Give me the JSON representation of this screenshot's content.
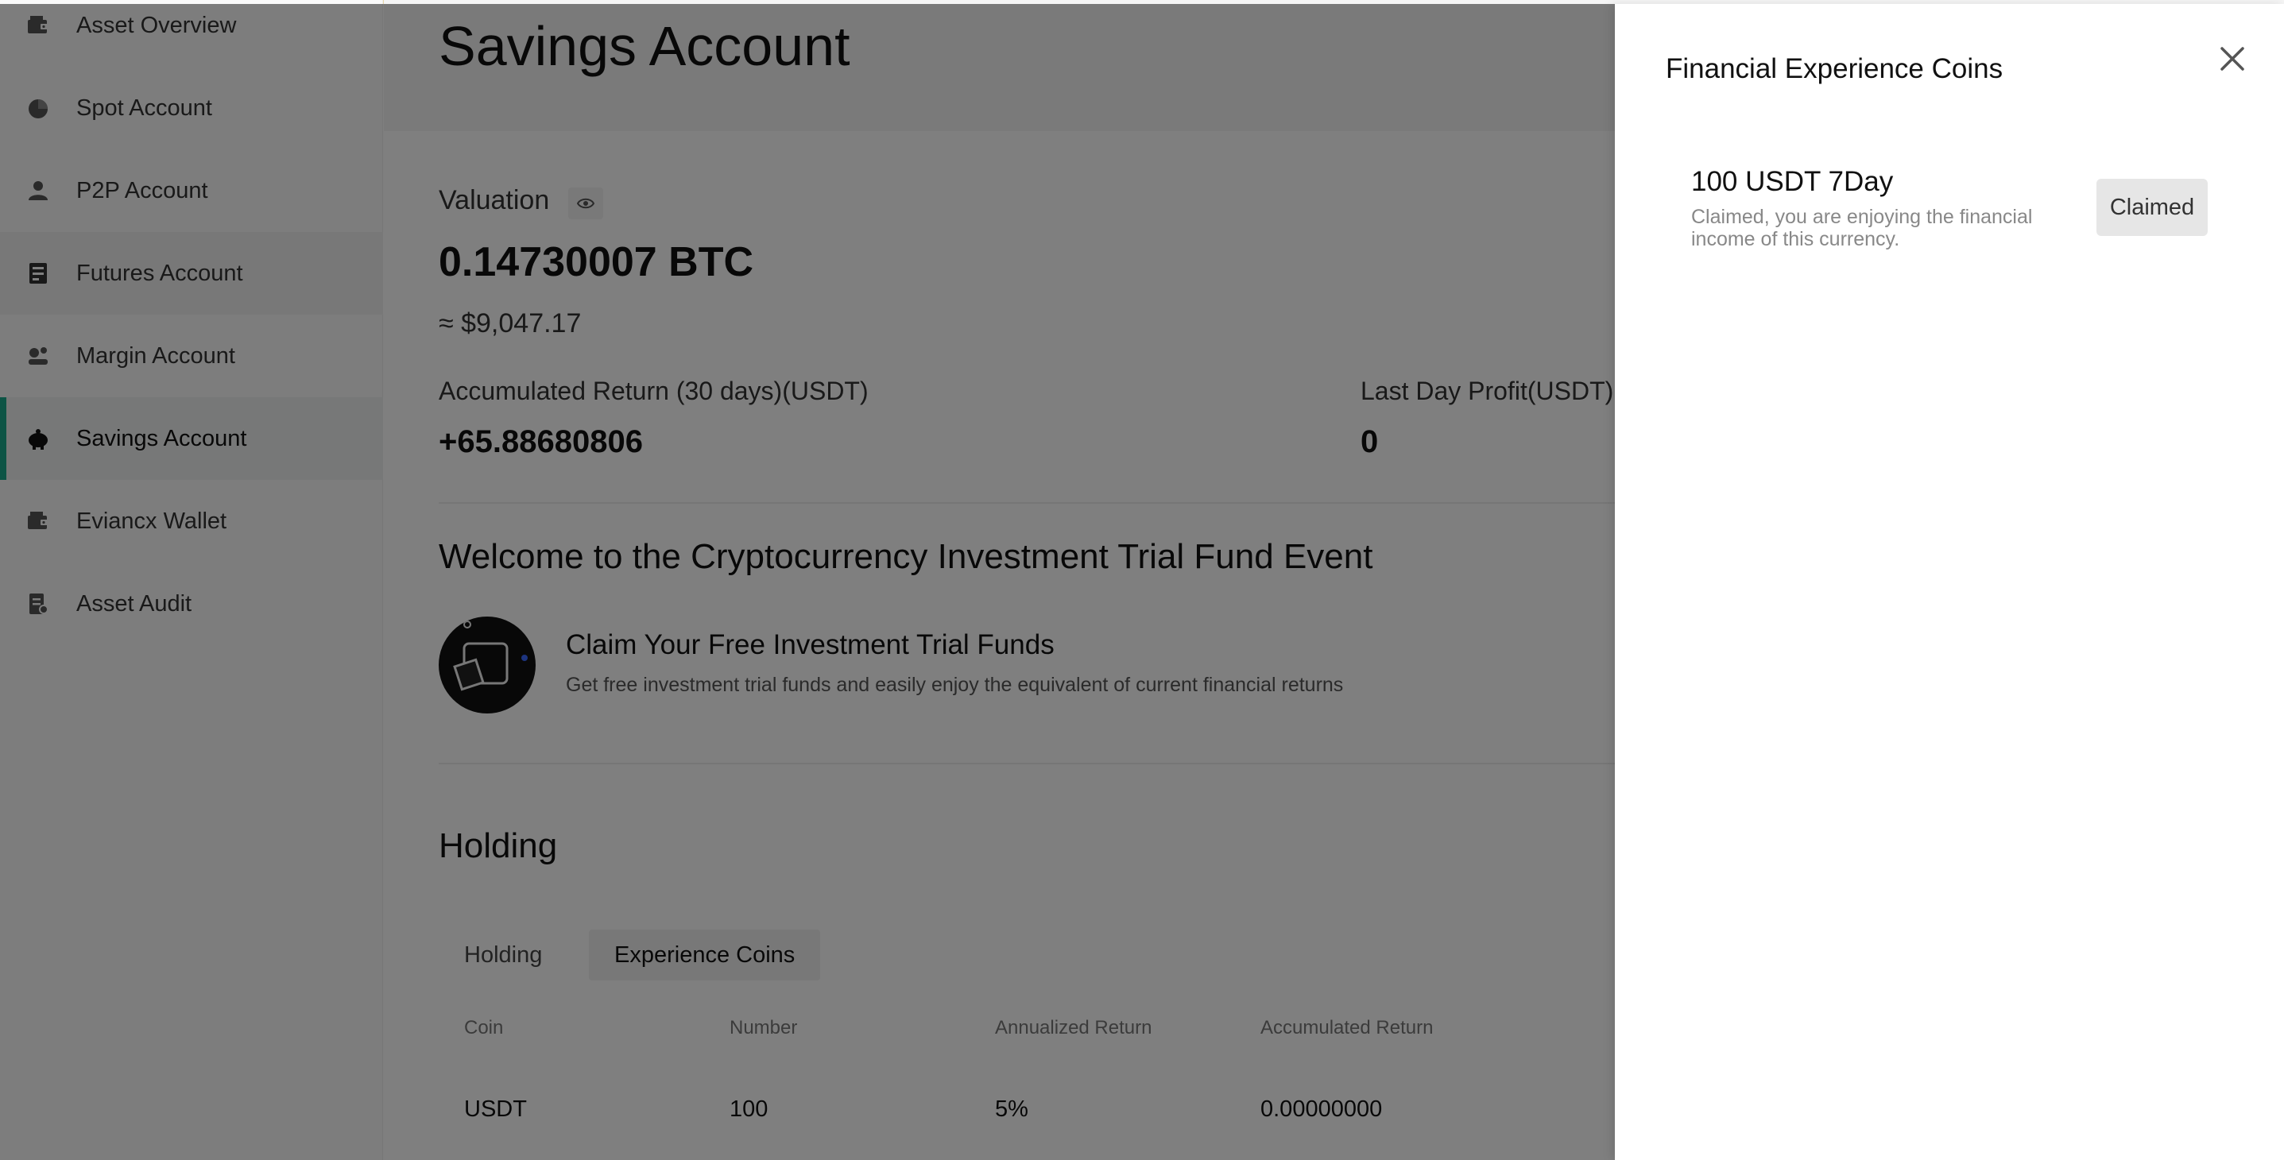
{
  "sidebar": {
    "items": [
      {
        "label": "Asset Overview",
        "icon": "wallet-icon"
      },
      {
        "label": "Spot Account",
        "icon": "pie-chart-icon"
      },
      {
        "label": "P2P Account",
        "icon": "user-icon"
      },
      {
        "label": "Futures Account",
        "icon": "futures-icon"
      },
      {
        "label": "Margin Account",
        "icon": "margin-icon"
      },
      {
        "label": "Savings Account",
        "icon": "piggy-bank-icon"
      },
      {
        "label": "Eviancx Wallet",
        "icon": "wallet-icon"
      },
      {
        "label": "Asset Audit",
        "icon": "audit-icon"
      }
    ],
    "active_item": "Savings Account",
    "accent_color": "#1aa88a"
  },
  "main": {
    "title": "Savings Account",
    "valuation_label": "Valuation",
    "btc_value": "0.14730007 BTC",
    "usd_value": "≈ $9,047.17",
    "accumulated_return_label": "Accumulated Return (30 days)(USDT)",
    "accumulated_return_value": "+65.88680806",
    "last_day_profit_label": "Last Day Profit(USDT)",
    "last_day_profit_value": "0",
    "event_title": "Welcome to the Cryptocurrency Investment Trial Fund Event",
    "claim_title": "Claim Your Free Investment Trial Funds",
    "claim_desc": "Get free investment trial funds and easily enjoy the equivalent of current financial returns",
    "holding_title": "Holding",
    "tabs": [
      {
        "label": "Holding"
      },
      {
        "label": "Experience Coins"
      }
    ],
    "active_tab": "Experience Coins",
    "table": {
      "headers": [
        "Coin",
        "Number",
        "Annualized Return",
        "Accumulated Return"
      ],
      "rows": [
        [
          "USDT",
          "100",
          "5%",
          "0.00000000"
        ]
      ]
    }
  },
  "drawer": {
    "title": "Financial Experience Coins",
    "coin_name": "100 USDT 7Day",
    "coin_desc": "Claimed, you are enjoying the financial income of this currency.",
    "claimed_label": "Claimed"
  }
}
